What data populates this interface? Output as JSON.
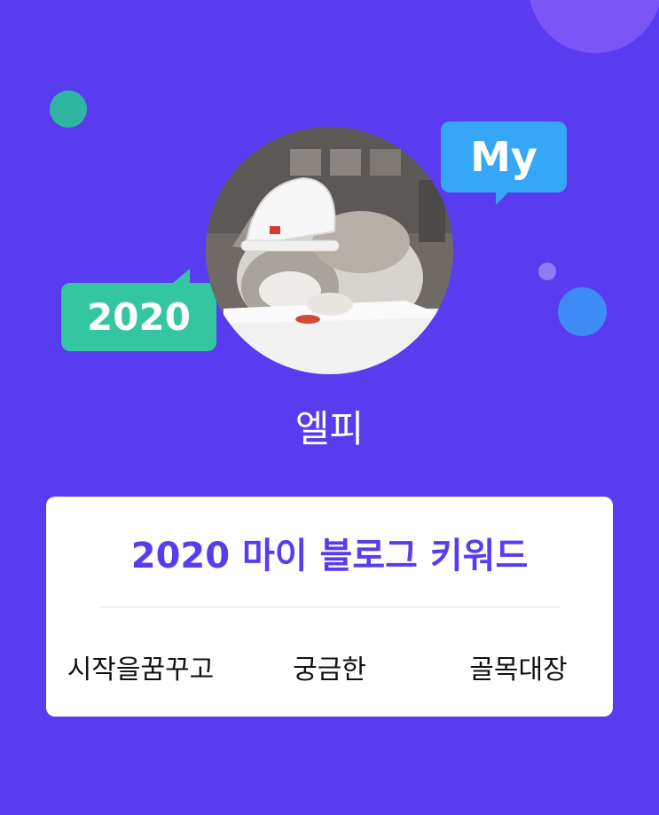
{
  "badges": {
    "my": "My",
    "year": "2020"
  },
  "profile": {
    "name": "엘피"
  },
  "keyword_card": {
    "title": "2020 마이 블로그 키워드",
    "keywords": [
      "시작을꿈꾸고",
      "궁금한",
      "골목대장"
    ]
  },
  "colors": {
    "background": "#5a3cf0",
    "accent_blue": "#36a6f7",
    "accent_teal": "#34c6a0",
    "title_text": "#5a3cf0"
  }
}
